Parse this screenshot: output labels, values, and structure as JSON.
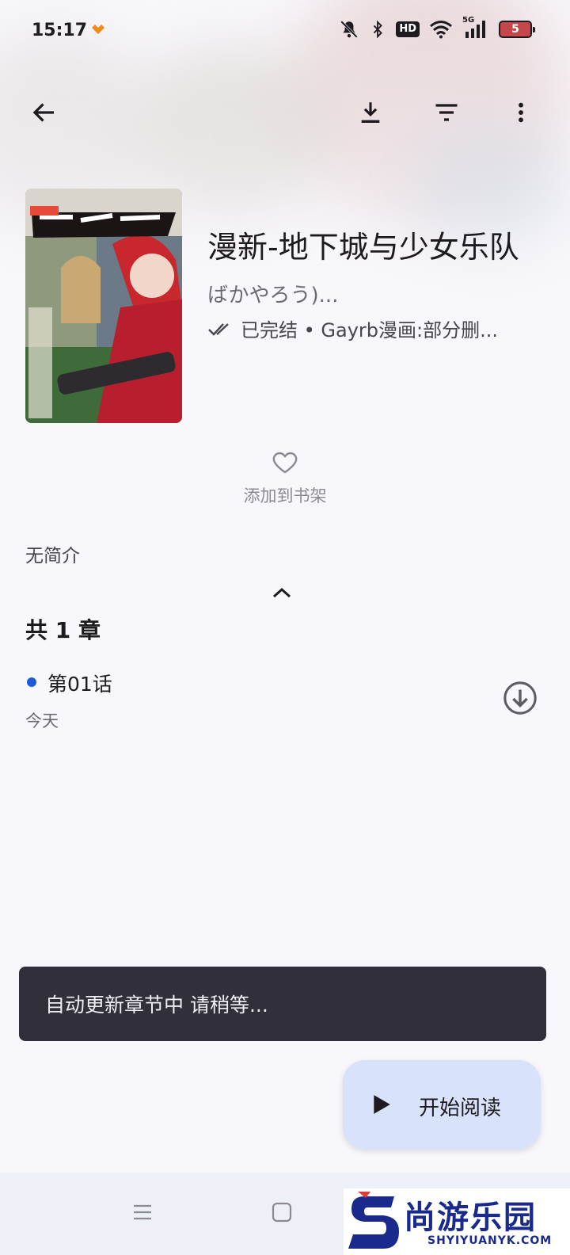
{
  "status_bar": {
    "time": "15:17",
    "hd_label": "HD",
    "network_label": "5G",
    "battery_level": "5"
  },
  "app_bar": {
    "back_icon": "arrow-left-icon",
    "download_icon": "download-icon",
    "filter_icon": "filter-icon",
    "more_icon": "more-vert-icon"
  },
  "manga": {
    "title": "漫新-地下城与少女乐队",
    "author": "ばかやろう)...",
    "status_text": "已完结 • Gayrb漫画:部分删...",
    "description": "无简介"
  },
  "favorite": {
    "label": "添加到书架",
    "icon": "heart-outline-icon"
  },
  "chapters": {
    "count_label": "共 1 章",
    "items": [
      {
        "name": "第01话",
        "date": "今天",
        "unread": true
      }
    ]
  },
  "snackbar": {
    "message": "自动更新章节中 请稍等..."
  },
  "fab": {
    "label": "开始阅读",
    "icon": "play-icon"
  },
  "watermark": {
    "cn": "尚游乐园",
    "en": "SHYIYUANYK.COM"
  },
  "colors": {
    "accent": "#1e5bd6",
    "fab_bg": "#d9e2fb",
    "snackbar_bg": "#31303a"
  }
}
